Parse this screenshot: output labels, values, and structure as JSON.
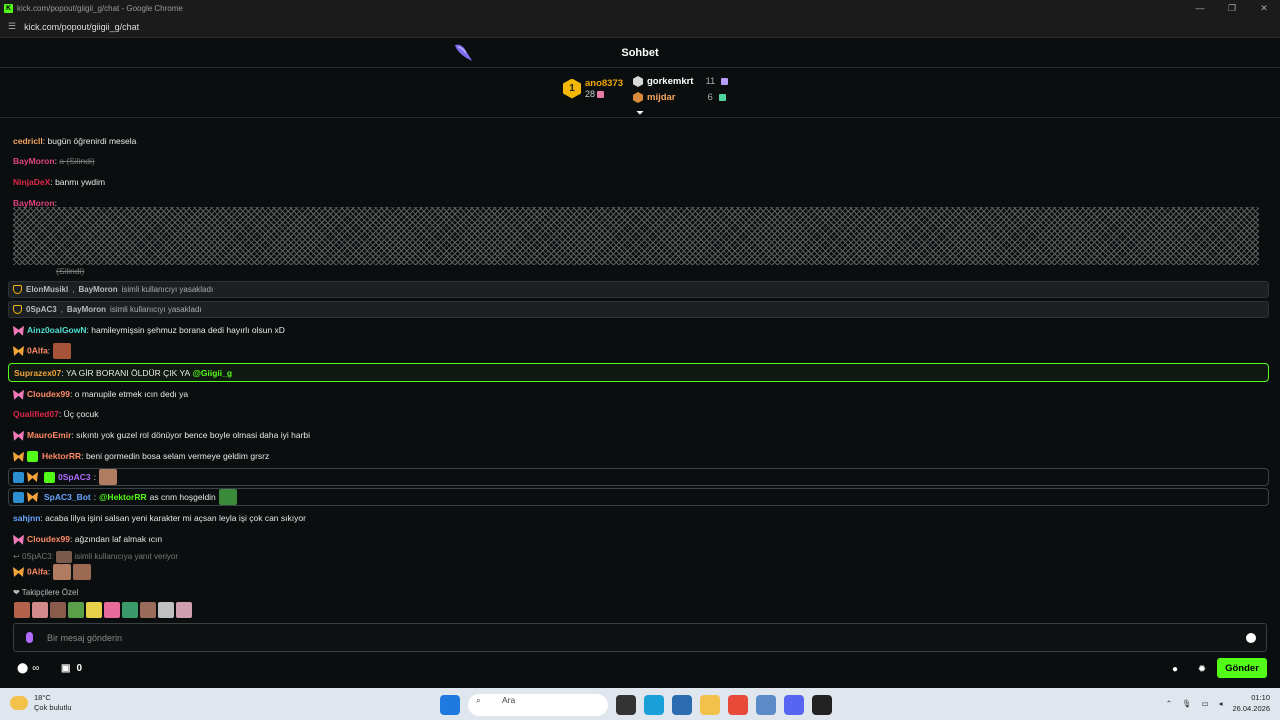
{
  "window": {
    "title": "kick.com/popout/giigii_g/chat - Google Chrome",
    "address": "kick.com/popout/giigii_g/chat"
  },
  "chat": {
    "title": "Sohbet",
    "leaderboard": {
      "first": {
        "rank": "1",
        "name": "ano8373",
        "count": "28"
      },
      "second": {
        "name": "gorkemkrt",
        "count": "11"
      },
      "third": {
        "name": "mijdar",
        "count": "6"
      }
    },
    "messages": [
      {
        "user": "cedricll",
        "user_color": "#f2a560",
        "text": "bugün öğrenirdi mesela"
      },
      {
        "user": "BayMoron",
        "user_color": "#e0457b",
        "text": "a (Silindi)"
      },
      {
        "user": "NinjaDeX",
        "user_color": "#e0284a",
        "text": "banmı ywdim"
      },
      {
        "user": "BayMoron",
        "user_color": "#e0457b",
        "text": "",
        "spam_deleted": "(Silindi)"
      },
      {
        "user": "Cloudex99",
        "user_color": "#ff8a65",
        "text": "o manupile etmek ıcın dedı ya"
      },
      {
        "user": "Qualified07",
        "user_color": "#e0284a",
        "text": "Üç çocuk"
      },
      {
        "user": "MauroEmir",
        "user_color": "#ff8a65",
        "text": "sıkıntı yok guzel rol dönüyor bence boyle olmasi daha iyi harbi"
      },
      {
        "user": "HektorRR",
        "user_color": "#ff8a65",
        "text": "beni gormedin bosa selam vermeye geldim grsrz"
      },
      {
        "user": "sahjnn",
        "user_color": "#6aa4ff",
        "text": "acaba lilya işini salsan yeni karakter mi açsan leyla işi çok can sıkıyor"
      },
      {
        "user": "Cloudex99",
        "user_color": "#ff8a65",
        "text": "ağzından laf almak ıcın"
      }
    ],
    "ban1": {
      "mod": "ElonMusikl",
      "target": "BayMoron",
      "text": "isimli kullanıcıyı yasakladı"
    },
    "ban2": {
      "mod": "0SpAC3",
      "target": "BayMoron",
      "text": "isimli kullanıcıyı yasakladı"
    },
    "ainz": {
      "user": "Ainz0oalGowN",
      "text": "hamileymişsin şehmuz borana dedi hayırlı olsun xD"
    },
    "alfa1": {
      "user": "0Alfa"
    },
    "highlight": {
      "user": "Suprazex07",
      "text": "YA GİR BORANI ÖLDÜR ÇIK YA",
      "mention": "@Giigii_g"
    },
    "spac3": {
      "user": "0SpAC3"
    },
    "bot": {
      "user": "SpAC3_Bot",
      "mention": "@HektorRR",
      "text": "as cnm hoşgeldin"
    },
    "reply": {
      "to": "0SpAC3:",
      "text": "isimli kullanıcıya yanıt veriyor"
    },
    "alfa2": {
      "user": "0Alfa"
    },
    "followers_only": "Takipçilere Özel",
    "input_placeholder": "Bir mesaj gönderin",
    "points": "0",
    "send_label": "Gönder"
  },
  "taskbar": {
    "temp": "18°C",
    "weather": "Çok bulutlu",
    "search": "Ara",
    "time": "01:10",
    "date": "26.04.2026"
  },
  "colors": {
    "accent": "#53fc18",
    "background": "#0b0e0f"
  }
}
